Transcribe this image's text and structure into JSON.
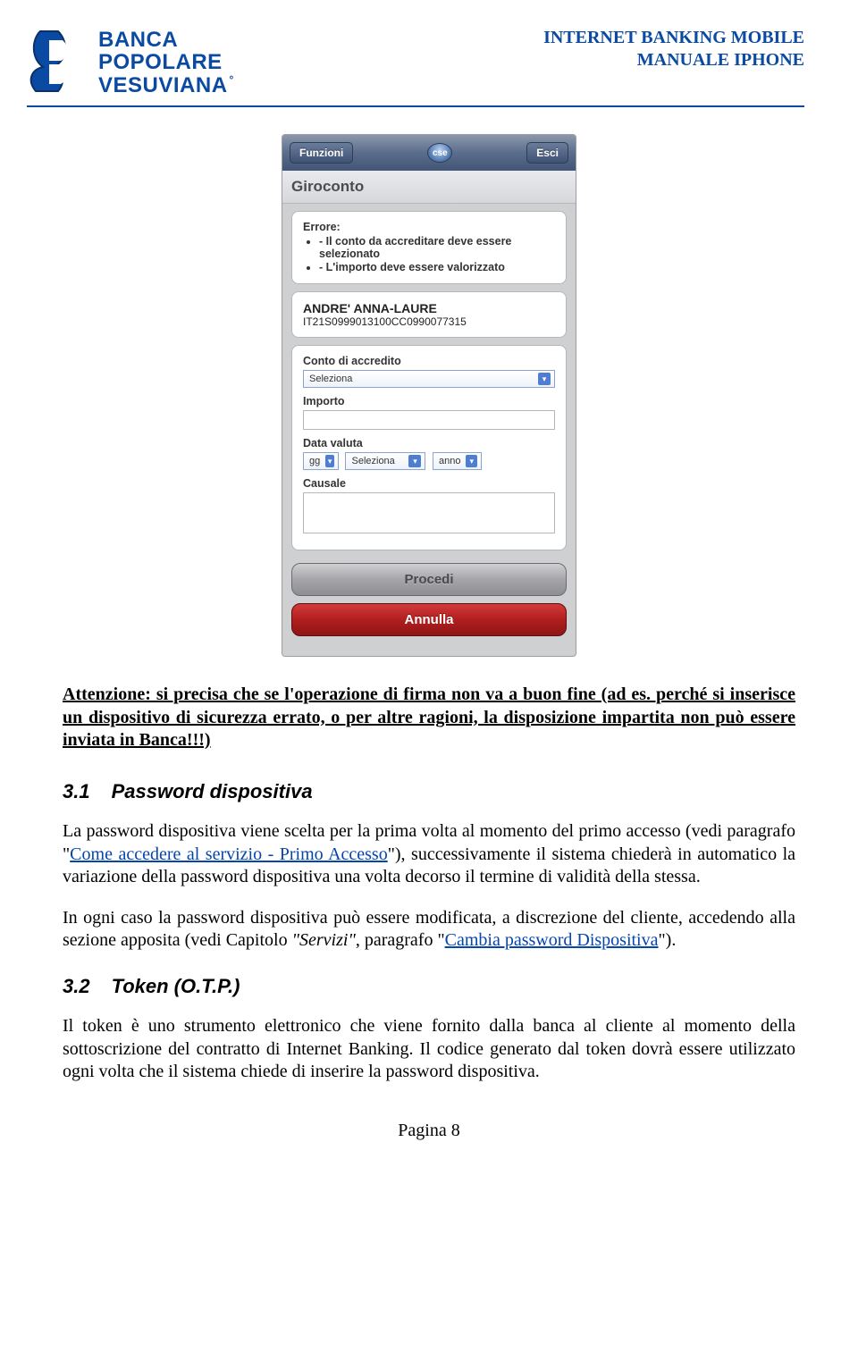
{
  "header": {
    "logo_line1": "BANCA",
    "logo_line2": "POPOLARE",
    "logo_line3": "VESUVIANA",
    "doc_title_line1": "INTERNET BANKING MOBILE",
    "doc_title_line2": "MANUALE IPHONE"
  },
  "screenshot": {
    "nav_left": "Funzioni",
    "nav_logo": "cse",
    "nav_right": "Esci",
    "section_title": "Giroconto",
    "error_title": "Errore:",
    "error_lines": [
      "- Il conto da accreditare deve essere selezionato",
      "- L'importo deve essere valorizzato"
    ],
    "account_name": "ANDRE' ANNA-LAURE",
    "account_iban": "IT21S0999013100CC0990077315",
    "labels": {
      "credit_account": "Conto di accredito",
      "amount": "Importo",
      "value_date": "Data valuta",
      "reason": "Causale"
    },
    "selects": {
      "credit_placeholder": "Seleziona",
      "day": "gg",
      "month": "Seleziona",
      "year": "anno"
    },
    "buttons": {
      "proceed": "Procedi",
      "cancel": "Annulla"
    }
  },
  "content": {
    "notice": "Attenzione: si precisa che se l'operazione di firma non va a buon fine (ad es. perché si inserisce un dispositivo di sicurezza errato, o per altre ragioni, la disposizione impartita non può essere inviata in Banca!!!)",
    "h31_num": "3.1",
    "h31_title": "Password dispositiva",
    "p1_a": "La password dispositiva viene scelta per la prima volta al momento del primo accesso (vedi paragrafo \"",
    "p1_link": "Come accedere al servizio - Primo Accesso",
    "p1_b": "\"), successivamente il sistema chiederà in automatico la variazione della password dispositiva una volta decorso il termine di validità della stessa.",
    "p2_a": "In ogni caso la password dispositiva può essere modificata, a discrezione del cliente, accedendo alla sezione apposita (vedi Capitolo ",
    "p2_ital1": "\"Servizi\"",
    "p2_b": ", paragrafo \"",
    "p2_link": "Cambia password Dispositiva",
    "p2_c": "\").",
    "h32_num": "3.2",
    "h32_title": "Token (O.T.P.)",
    "p3": "Il token è uno strumento elettronico che viene fornito dalla banca al cliente al momento della sottoscrizione del contratto di Internet Banking. Il codice generato dal token dovrà essere utilizzato ogni volta che il sistema chiede di inserire la password dispositiva.",
    "page_number": "Pagina 8"
  }
}
